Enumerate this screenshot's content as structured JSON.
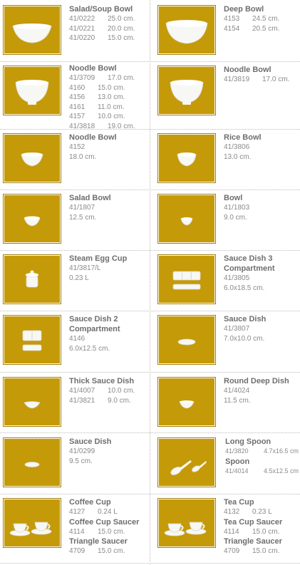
{
  "products": [
    {
      "name": "Salad/Soup Bowl",
      "icon": "wide-bowl-icon",
      "lines": [
        {
          "code": "41/0222",
          "value": "25.0 cm."
        },
        {
          "code": "41/0221",
          "value": "20.0 cm."
        },
        {
          "code": "41/0220",
          "value": "15.0 cm."
        }
      ]
    },
    {
      "name": "Deep Bowl",
      "icon": "deep-bowl-icon",
      "lines": [
        {
          "code": "4153",
          "value": "24.5 cm."
        },
        {
          "code": "4154",
          "value": "20.5 cm."
        }
      ]
    },
    {
      "name": "Noodle Bowl",
      "icon": "noodle-bowl-icon",
      "lines": [
        {
          "code": "41/3709",
          "value": "17.0 cm."
        },
        {
          "code": "4160",
          "value": "15.0 cm."
        },
        {
          "code": "4156",
          "value": "13.0 cm."
        },
        {
          "code": "4161",
          "value": "11.0 cm."
        },
        {
          "code": "4157",
          "value": "10.0 cm."
        },
        {
          "code": "41/3818",
          "value": "19.0 cm."
        }
      ]
    },
    {
      "name": "Noodle Bowl",
      "icon": "noodle-bowl-icon",
      "lines": [
        {
          "code": "41/3819",
          "value": "17.0 cm."
        }
      ]
    },
    {
      "name": "Noodle Bowl",
      "icon": "small-bowl-icon",
      "lines": [
        {
          "code": "4152",
          "value": ""
        },
        {
          "code": "18.0 cm.",
          "value": ""
        }
      ]
    },
    {
      "name": "Rice Bowl",
      "icon": "rice-bowl-icon",
      "lines": [
        {
          "code": "41/3806",
          "value": ""
        },
        {
          "code": "13.0 cm.",
          "value": ""
        }
      ]
    },
    {
      "name": "Salad Bowl",
      "icon": "salad-bowl-icon",
      "lines": [
        {
          "code": "41/1807",
          "value": ""
        },
        {
          "code": "12.5 cm.",
          "value": ""
        }
      ]
    },
    {
      "name": "Bowl",
      "icon": "tiny-bowl-icon",
      "lines": [
        {
          "code": "41/1803",
          "value": ""
        },
        {
          "code": "9.0 cm.",
          "value": ""
        }
      ]
    },
    {
      "name": "Steam Egg Cup",
      "icon": "egg-cup-icon",
      "lines": [
        {
          "code": "41/3817/L",
          "value": ""
        },
        {
          "code": "0.23 L",
          "value": ""
        }
      ]
    },
    {
      "name": "Sauce Dish 3\nCompartment",
      "icon": "three-compartment-dish-icon",
      "lines": [
        {
          "code": "41/3805",
          "value": ""
        },
        {
          "code": "6.0x18.5 cm.",
          "value": ""
        }
      ]
    },
    {
      "name": "Sauce Dish 2\nCompartment",
      "icon": "two-compartment-dish-icon",
      "lines": [
        {
          "code": "4146",
          "value": ""
        },
        {
          "code": "6.0x12.5 cm.",
          "value": ""
        }
      ]
    },
    {
      "name": "Sauce Dish",
      "icon": "oval-dish-icon",
      "lines": [
        {
          "code": "41/3807",
          "value": ""
        },
        {
          "code": "7.0x10.0 cm.",
          "value": ""
        }
      ]
    },
    {
      "name": "Thick Sauce Dish",
      "icon": "thick-dish-icon",
      "lines": [
        {
          "code": "41/4007",
          "value": "10.0 cm."
        },
        {
          "code": "41/3821",
          "value": "9.0 cm."
        }
      ]
    },
    {
      "name": "Round Deep Dish",
      "icon": "round-deep-dish-icon",
      "lines": [
        {
          "code": "41/4024",
          "value": ""
        },
        {
          "code": "11.5 cm.",
          "value": ""
        }
      ]
    },
    {
      "name": "Sauce Dish",
      "icon": "round-dish-icon",
      "lines": [
        {
          "code": "41/0299",
          "value": ""
        },
        {
          "code": "9.5 cm.",
          "value": ""
        }
      ]
    },
    {
      "name": "Long Spoon",
      "icon": "spoon-icon",
      "lines": [
        {
          "code": "41/3820",
          "value": "4.7x16.5 cm"
        }
      ],
      "name2": "Spoon",
      "lines2": [
        {
          "code": "41/4014",
          "value": "4.5x12.5 cm"
        }
      ]
    },
    {
      "name": "Coffee Cup",
      "icon": "coffee-cup-icon",
      "lines": [
        {
          "code": "4127",
          "value": "0.24 L"
        }
      ],
      "name2": "Coffee Cup Saucer",
      "lines2": [
        {
          "code": "4114",
          "value": "15.0 cm."
        }
      ],
      "name3": "Triangle Saucer",
      "lines3": [
        {
          "code": "4709",
          "value": "15.0 cm."
        }
      ]
    },
    {
      "name": "Tea Cup",
      "icon": "tea-cup-icon",
      "lines": [
        {
          "code": "4132",
          "value": "0.23 L"
        }
      ],
      "name2": "Tea Cup Saucer",
      "lines2": [
        {
          "code": "4114",
          "value": "15.0 cm."
        }
      ],
      "name3": "Triangle Saucer",
      "lines3": [
        {
          "code": "4709",
          "value": "15.0 cm."
        }
      ]
    }
  ],
  "colors": {
    "thumb_bg": "#c59a08",
    "porcelain": "#f7f7f4",
    "text": "#8a8a8a",
    "title": "#6e6e6e"
  }
}
